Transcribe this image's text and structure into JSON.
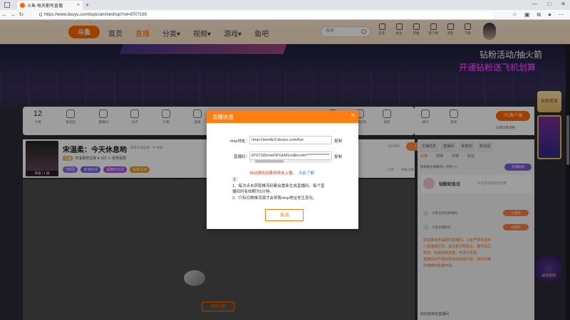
{
  "browser": {
    "tab_title": "斗鱼-每天都有直播",
    "tab_close": "×",
    "new_tab": "+",
    "url": "https://www.douyu.com/topic/animeshop?rid=8707195",
    "window_controls": [
      "—",
      "□",
      "✕"
    ],
    "nav": [
      "←",
      "→",
      "↻"
    ]
  },
  "site": {
    "logo": "斗鱼",
    "nav": [
      "首页",
      "直播",
      "分类▾",
      "视频▾",
      "游戏▾",
      "鱼吧"
    ],
    "active_nav_index": 1,
    "search_placeholder": "搜索",
    "header_icons": [
      "历史",
      "关注",
      "开播",
      "客户端",
      "消息",
      "下载"
    ],
    "brand_color": "#ff6a00"
  },
  "promo": {
    "line1": "钻粉活动/抽火箭",
    "line2": "开通钻粉送飞机划算"
  },
  "toolstrip": {
    "count": "12",
    "tools": [
      "大神",
      "粉丝团",
      "直播间",
      "分享",
      "礼物",
      "鱼塘",
      "贵族",
      "主播任务",
      "语音",
      "排行",
      "福利",
      "更多"
    ]
  },
  "pc_client": {
    "button": "PC客户端",
    "sub": "比网页更流畅"
  },
  "room": {
    "title": "宋温柔：今天休息哟",
    "meta": "·    看看其他直播    ·    ⚑ 举报",
    "level": "等级 / 1 级",
    "anchor_badge": "主播",
    "anchor": "宋温柔的宝库   ♥ 162   ☆ 看电视剧",
    "tags": [
      "V粉团",
      "颜值粉团",
      "超精粉丝团",
      "钻粉活动"
    ],
    "follow": "+ 关注",
    "follow_count": "102494",
    "ops": [
      "分享",
      "举报主播"
    ]
  },
  "player": {
    "button": "去看主播"
  },
  "right_panel": {
    "tabs": [
      "主播任务",
      "直播间",
      "贵宾(0)",
      "粉丝团"
    ],
    "subtabs": [
      "日榜",
      "周榜",
      "月榜",
      "粉丝"
    ],
    "active_subtab": 0,
    "line": "快来和主播来玩一玩吧 >>",
    "open_btn": "开通钻粉",
    "card_title": "钻粉纪念日",
    "card_sub": "今天还有钻粉活动哦",
    "rows": [
      {
        "text": "大帮主的钻粉福利",
        "btn": "火箭开"
      },
      {
        "text": "大帮主福利包",
        "btn": "火箭开"
      }
    ],
    "notice": [
      "欢迎来到宋温柔的直播间，斗鱼严禁未成年",
      "人直播或打赏，请注意文明发言，遵守社区",
      "规范。如遇违规直播，可进行举报。",
      "直播间内严禁出现违法违规内容，请共同维",
      "护健康的直播环境。"
    ],
    "welcome": "欢迎来到本直播间"
  },
  "game_badge": "战地游戏",
  "gift_side": "玩家盛宴",
  "modal": {
    "title": "直播信息",
    "close": "×",
    "rtmp_label": "rtmp地址：",
    "rtmp_value": "rtmp://sendtc3.douyu.com/live",
    "key_label": "直播码：",
    "key_value": "8707195rnwFIFGkM1ns$ecret=***************",
    "copy": "复制",
    "warning": "自动调码如果持续未上播，",
    "warning_link": "点此了解",
    "notes": [
      "注：",
      "1、每次点击获取推流码都会重新生成直播码，每个直",
      "    播码的有效期为5分钟。",
      "2、只有切换推流源才会导致rtmp地址发生变化。"
    ],
    "close_button": "关闭",
    "header_color": "#ff7d12"
  }
}
